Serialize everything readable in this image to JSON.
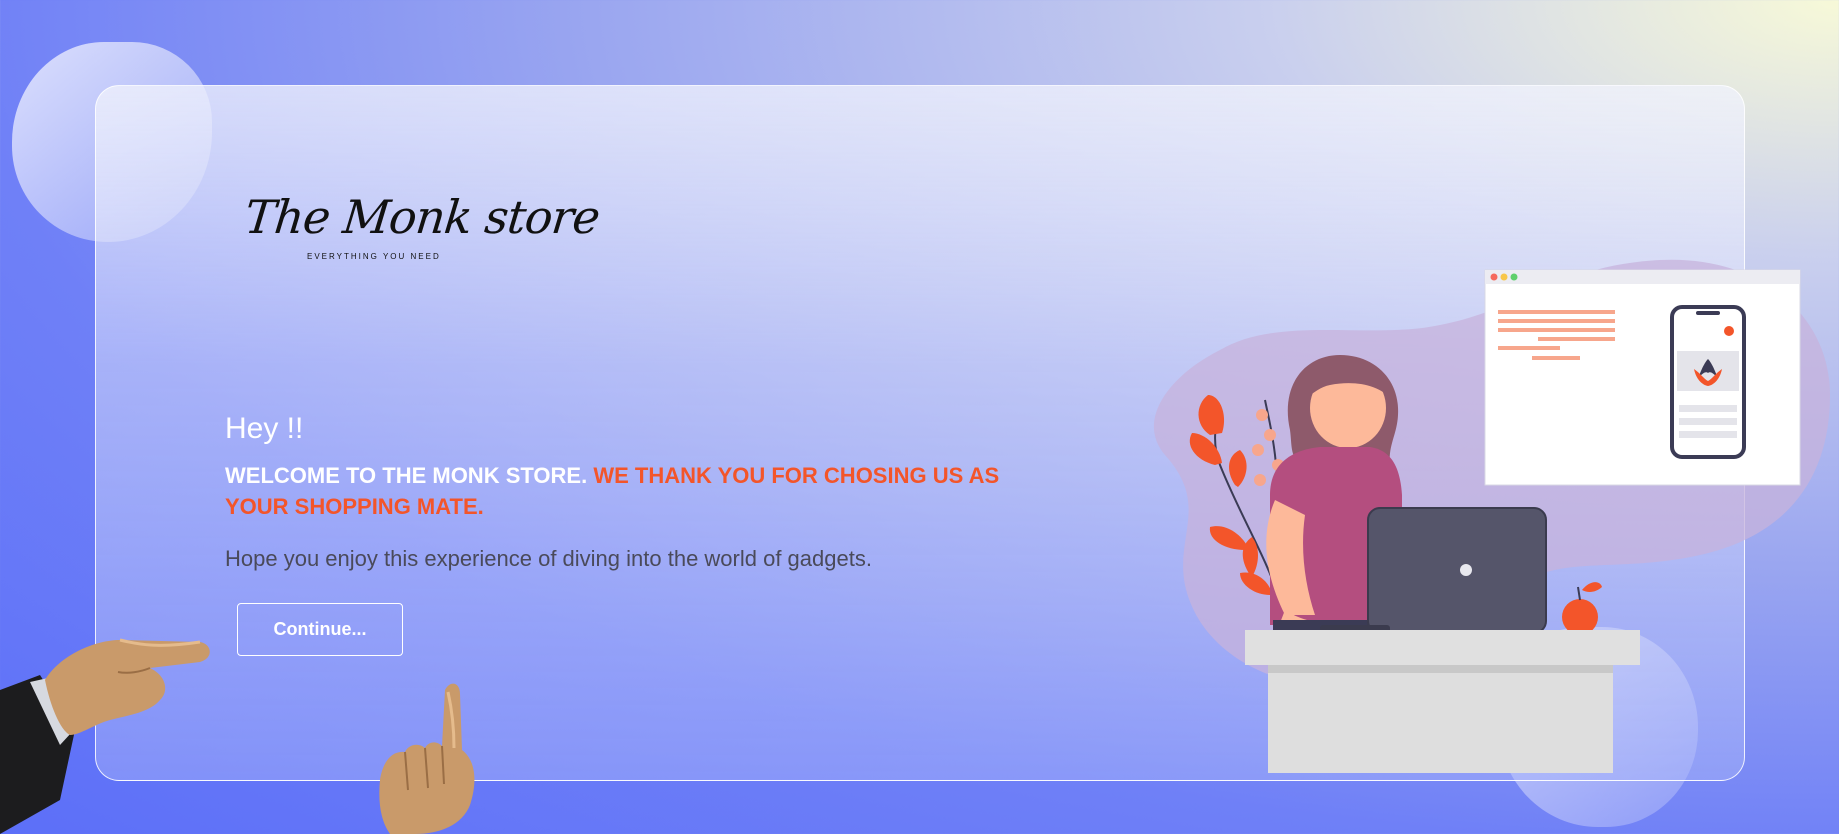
{
  "brand": {
    "logo_text": "The Monk store",
    "tagline": "EVERYTHING YOU NEED"
  },
  "hero": {
    "greeting": "Hey !!",
    "welcome_white": "WELCOME TO THE MONK STORE.",
    "welcome_orange": "WE THANK YOU FOR CHOSING US AS YOUR SHOPPING MATE.",
    "subtitle": "Hope you enjoy this experience of diving into the world of gadgets."
  },
  "actions": {
    "continue_label": "Continue..."
  },
  "colors": {
    "accent_orange": "#f3552a",
    "text_white": "#ffffff",
    "text_dark": "#4a4a5a"
  },
  "icons": [
    "pointing-hand-left-icon",
    "pointing-hand-up-icon"
  ]
}
